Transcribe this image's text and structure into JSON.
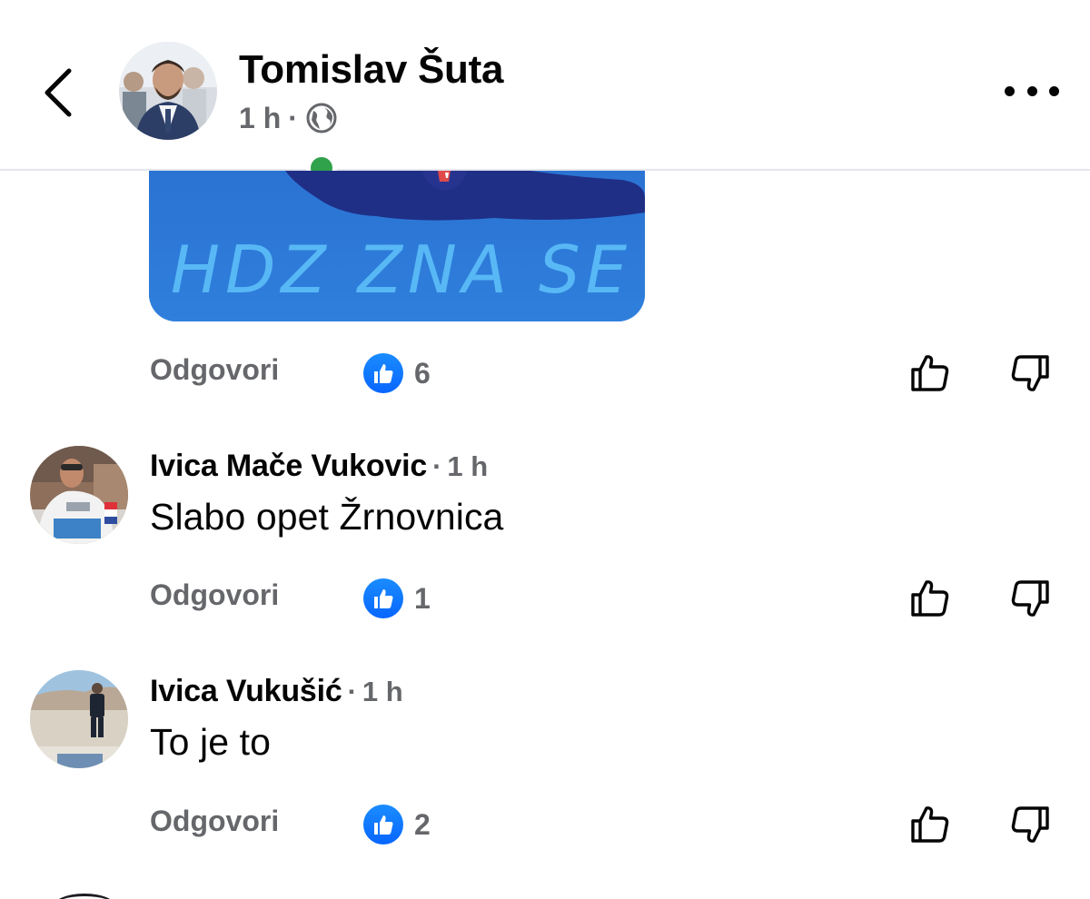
{
  "header": {
    "author_name": "Tomislav Šuta",
    "time": "1 h",
    "separator": "·",
    "audience_icon": "globe-icon",
    "back_icon": "chevron-left-icon",
    "more_icon": "more-horizontal-icon",
    "online_status_color": "#31a24c"
  },
  "attachment": {
    "image_text": "HDZ ZNA SE",
    "background_color": "#2d79d6",
    "text_color": "#58b8f5"
  },
  "post_actions": {
    "reply_label": "Odgovori",
    "like_count": "6",
    "like_icon": "like-badge-icon",
    "upvote_icon": "thumbs-up-outline-icon",
    "downvote_icon": "thumbs-down-outline-icon"
  },
  "comments": [
    {
      "author": "Ivica Mače Vukovic",
      "separator": "·",
      "time": "1 h",
      "text": "Slabo opet Žrnovnica",
      "reply_label": "Odgovori",
      "like_count": "1"
    },
    {
      "author": "Ivica Vukušić",
      "separator": "·",
      "time": "1 h",
      "text": "To je to",
      "reply_label": "Odgovori",
      "like_count": "2"
    }
  ],
  "colors": {
    "primary_text": "#050505",
    "secondary_text": "#65676b",
    "like_blue": "#0866ff",
    "divider": "#e4e6eb"
  }
}
